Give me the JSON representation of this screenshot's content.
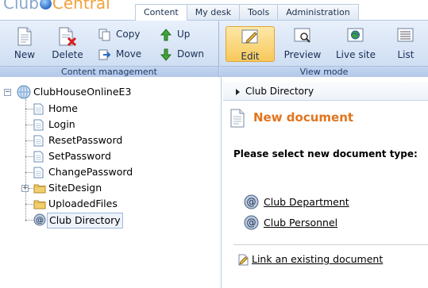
{
  "logo": {
    "part1": "Club",
    "part2": "Central"
  },
  "tabs": [
    {
      "label": "Content"
    },
    {
      "label": "My desk"
    },
    {
      "label": "Tools"
    },
    {
      "label": "Administration"
    }
  ],
  "ribbon": {
    "content_group_label": "Content management",
    "view_group_label": "View mode",
    "new_label": "New",
    "delete_label": "Delete",
    "copy_label": "Copy",
    "move_label": "Move",
    "up_label": "Up",
    "down_label": "Down",
    "edit_label": "Edit",
    "preview_label": "Preview",
    "livesite_label": "Live site",
    "list_label": "List"
  },
  "tree": {
    "root": "ClubHouseOnlineE3",
    "items": [
      {
        "label": "Home"
      },
      {
        "label": "Login"
      },
      {
        "label": "ResetPassword"
      },
      {
        "label": "SetPassword"
      },
      {
        "label": "ChangePassword"
      },
      {
        "label": "SiteDesign"
      },
      {
        "label": "UploadedFiles"
      },
      {
        "label": "Club Directory"
      }
    ]
  },
  "right": {
    "breadcrumb": "Club Directory",
    "title": "New document",
    "prompt": "Please select new document type:",
    "doc_types": [
      {
        "label": "Club Department"
      },
      {
        "label": "Club Personnel"
      }
    ],
    "link_existing": "Link an existing document"
  },
  "colors": {
    "accent": "#e2741d",
    "ribbon_bg": "#d6e3f5",
    "selected_button": "#f8c85a"
  }
}
